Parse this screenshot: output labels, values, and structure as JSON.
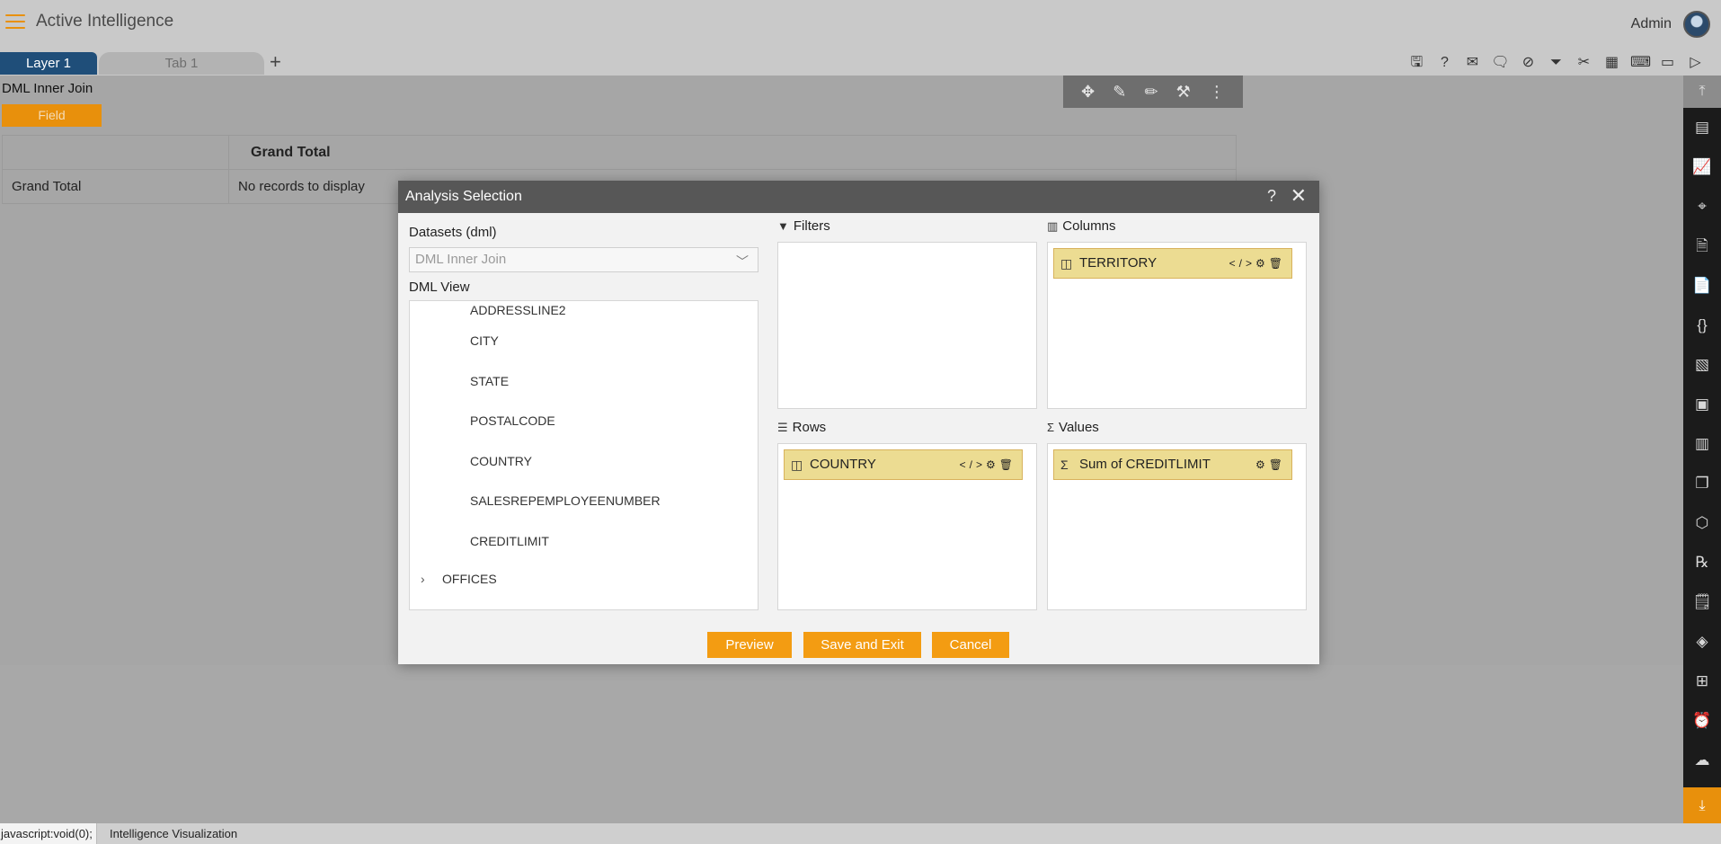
{
  "header": {
    "app_title": "Active Intelligence",
    "user": "Admin"
  },
  "tabs": {
    "layer": "Layer 1",
    "tab": "Tab 1",
    "add": "+"
  },
  "toolbar": {
    "icons": [
      "save-icon",
      "help-icon",
      "mail-icon",
      "comment-icon",
      "clear-filter-icon",
      "filter-icon",
      "tools-icon",
      "table-icon",
      "embed-icon",
      "devices-icon",
      "play-icon"
    ]
  },
  "widget": {
    "title": "DML Inner Join",
    "field_chip": "Field",
    "table": {
      "col_header": "Grand Total",
      "row_header": "Grand Total",
      "cell": "No records to display"
    }
  },
  "dialog": {
    "title": "Analysis Selection",
    "help": "?",
    "close": "✕",
    "datasets_label": "Datasets (dml)",
    "dataset_value": "DML Inner Join",
    "dml_view_label": "DML View",
    "dml_items": [
      "ADDRESSLINE2",
      "CITY",
      "STATE",
      "POSTALCODE",
      "COUNTRY",
      "SALESREPEMPLOYEENUMBER",
      "CREDITLIMIT"
    ],
    "dml_folder": "OFFICES",
    "filters_label": "Filters",
    "columns_label": "Columns",
    "rows_label": "Rows",
    "values_label": "Values",
    "columns_chip": "TERRITORY",
    "rows_chip": "COUNTRY",
    "values_chip": "Sum of CREDITLIMIT",
    "buttons": {
      "preview": "Preview",
      "save_exit": "Save and Exit",
      "cancel": "Cancel"
    }
  },
  "statusbar": {
    "url": "javascript:void(0);",
    "text": "Intelligence Visualization"
  },
  "colors": {
    "accent": "#e8900c",
    "tab_active": "#1f4e79",
    "chip": "#ecdc92",
    "dialog_header": "#575757"
  }
}
